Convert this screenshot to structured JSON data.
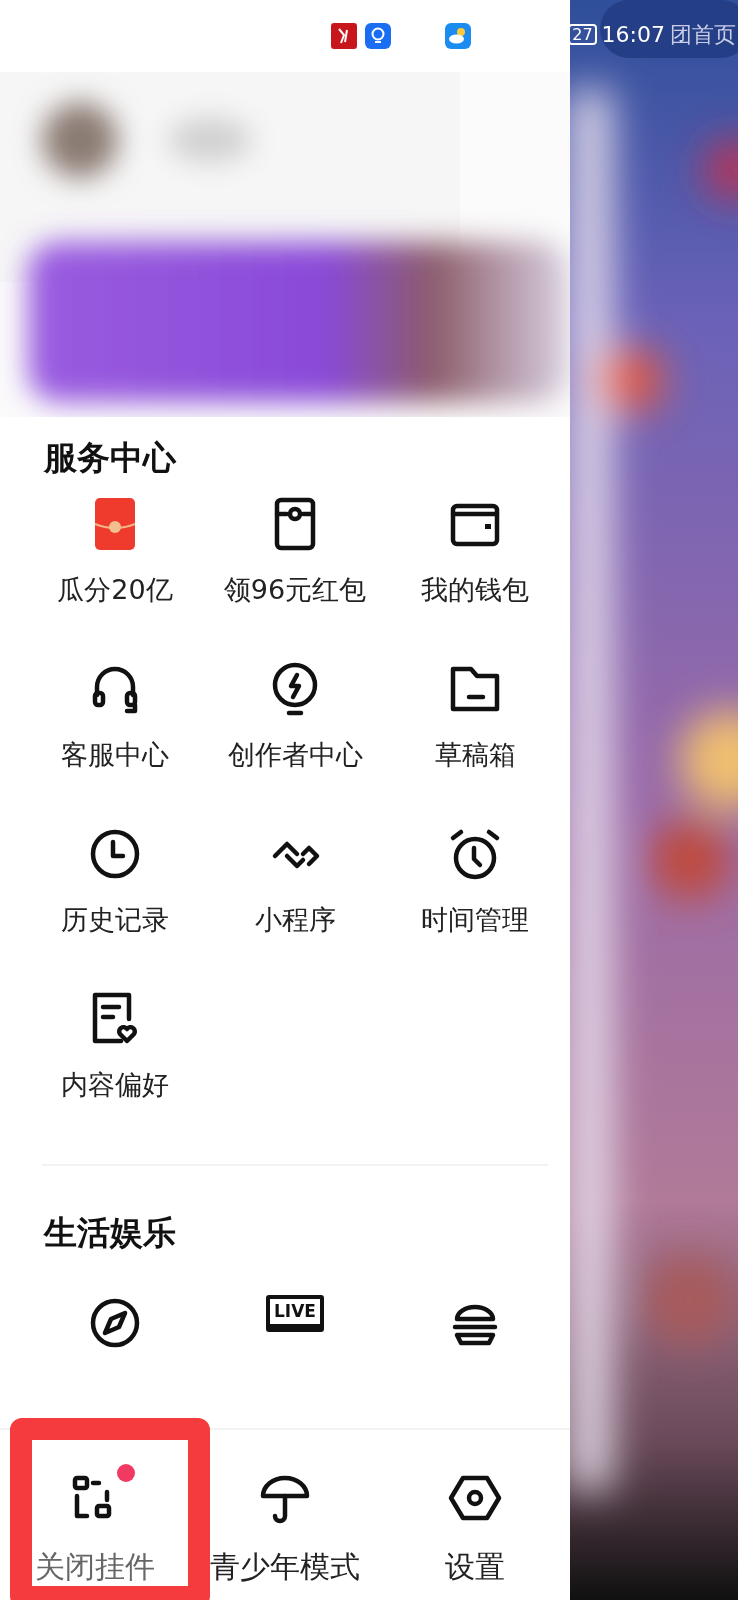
{
  "status_bar": {
    "battery": "27",
    "time": "16:07",
    "behind_text": "团首页"
  },
  "service_center": {
    "title": "服务中心",
    "items": [
      {
        "label": "瓜分20亿"
      },
      {
        "label": "领96元红包"
      },
      {
        "label": "我的钱包"
      },
      {
        "label": "客服中心"
      },
      {
        "label": "创作者中心"
      },
      {
        "label": "草稿箱"
      },
      {
        "label": "历史记录"
      },
      {
        "label": "小程序"
      },
      {
        "label": "时间管理"
      },
      {
        "label": "内容偏好"
      }
    ]
  },
  "life_entertainment": {
    "title": "生活娱乐",
    "items": [
      {
        "kind": "compass"
      },
      {
        "kind": "live",
        "icon_text": "LIVE"
      },
      {
        "kind": "burger"
      }
    ]
  },
  "bottom_bar": [
    {
      "label": "关闭挂件",
      "notification": true,
      "highlighted": true
    },
    {
      "label": "青少年模式",
      "notification": false,
      "highlighted": false
    },
    {
      "label": "设置",
      "notification": false,
      "highlighted": false
    }
  ]
}
